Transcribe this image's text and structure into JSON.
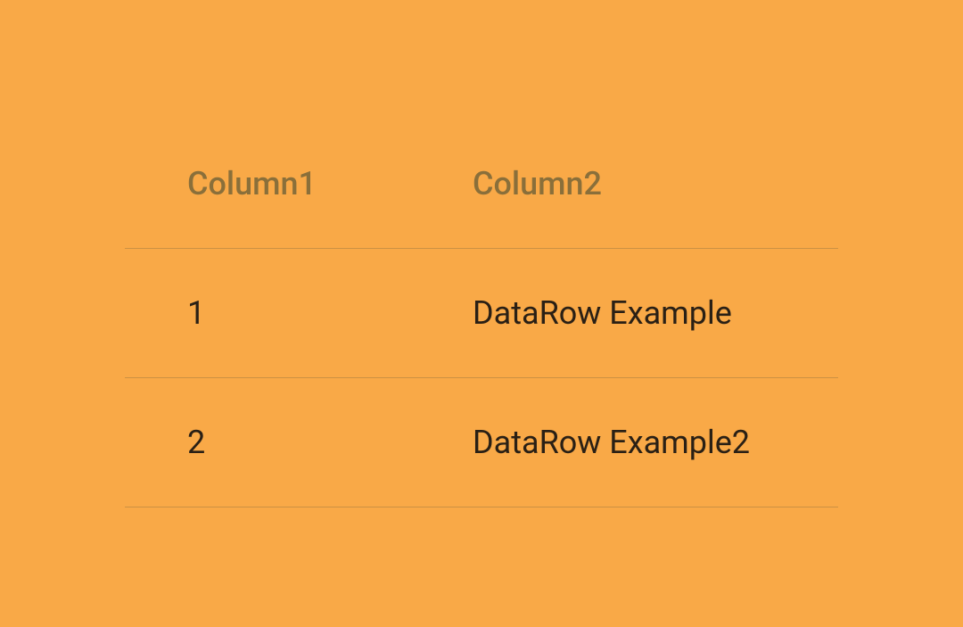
{
  "table": {
    "columns": [
      "Column1",
      "Column2"
    ],
    "rows": [
      {
        "col1": "1",
        "col2": "DataRow Example"
      },
      {
        "col1": "2",
        "col2": "DataRow Example2"
      }
    ]
  }
}
